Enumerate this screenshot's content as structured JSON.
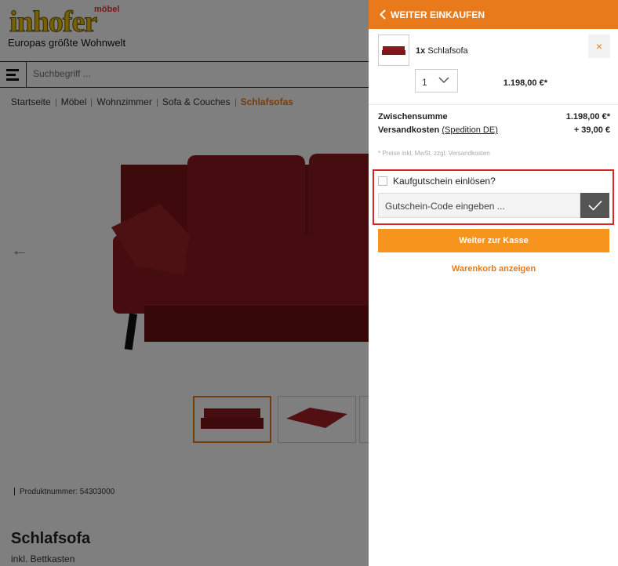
{
  "brand": {
    "word": "inhofer",
    "small": "möbel",
    "tagline": "Europas größte Wohnwelt"
  },
  "search": {
    "placeholder": "Suchbegriff ..."
  },
  "breadcrumb": [
    "Startseite",
    "Möbel",
    "Wohnzimmer",
    "Sofa & Couches",
    "Schlafsofas"
  ],
  "product": {
    "number_label": "Produktnummer: 54303000",
    "title": "Schlafsofa",
    "subtitle": "inkl. Bettkasten"
  },
  "cart": {
    "back_label": "WEITER EINKAUFEN",
    "item": {
      "qty_prefix": "1x",
      "name": "Schlafsofa",
      "quantity": "1",
      "price": "1.198,00 €*",
      "remove": "×"
    },
    "subtotal_label": "Zwischensumme",
    "subtotal_value": "1.198,00 €*",
    "shipping_label": "Versandkosten",
    "shipping_link": "(Spedition DE)",
    "shipping_value": "+ 39,00 €",
    "note": "* Preise inkl. MwSt. zzgl. Versandkosten",
    "voucher_label": "Kaufgutschein einlösen?",
    "voucher_placeholder": "Gutschein-Code eingeben ...",
    "checkout_label": "Weiter zur Kasse",
    "view_cart_label": "Warenkorb anzeigen"
  },
  "colors": {
    "accent": "#e87a1c",
    "button": "#f7941d",
    "highlight": "#d9262c",
    "sofa": "#8a1a1e"
  }
}
